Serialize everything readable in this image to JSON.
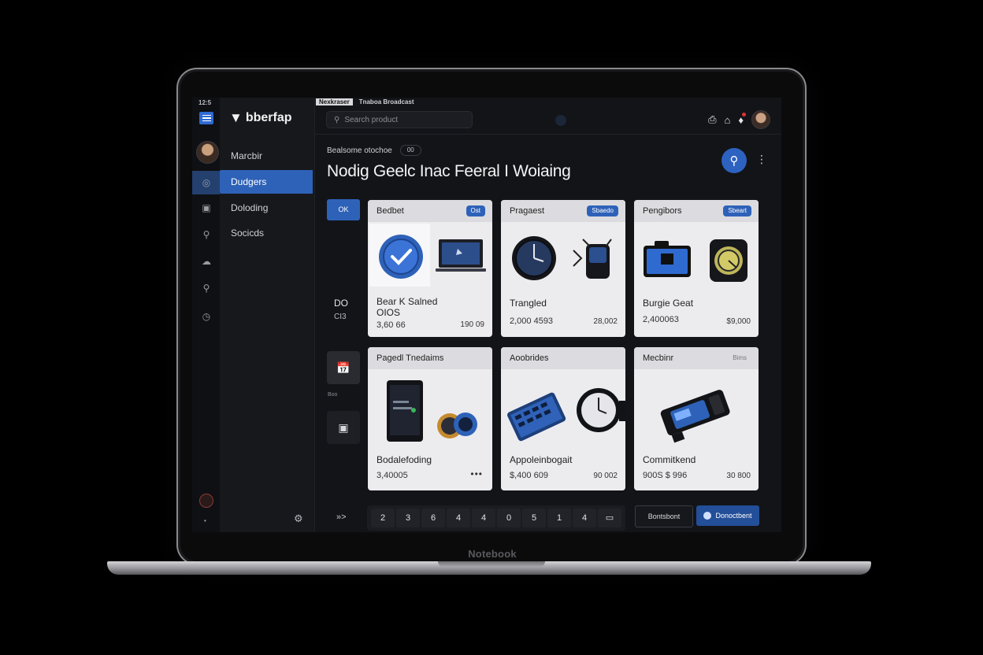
{
  "device": {
    "brand_label": "Notebook"
  },
  "rail": {
    "tiny_text": "12:5"
  },
  "app": {
    "logo_text": "bberfap"
  },
  "topbar": {
    "tabs": [
      "Nexkraser",
      "Tnaboa Broadcast"
    ],
    "search_placeholder": "Search product"
  },
  "nav": {
    "items": [
      {
        "label": "Marcbir"
      },
      {
        "label": "Dudgers"
      },
      {
        "label": "Doloding"
      },
      {
        "label": "Socicds"
      }
    ]
  },
  "header": {
    "breadcrumb": "Bealsome otochoe",
    "breadcrumb_pill": "00",
    "title": "Nodig Geelc Inac Feeral I Woiaing"
  },
  "left_column": {
    "ok_label": "OK",
    "stat_1": "DO",
    "stat_2": "CI3",
    "mini_label": "Boo"
  },
  "cards": [
    {
      "title": "Bedbet",
      "tag": "Ost",
      "name": "Bear K Salned\nOIOS",
      "value": "3,60 66",
      "price": "190 09"
    },
    {
      "title": "Pragaest",
      "tag": "Sbaedo",
      "name": "Trangled",
      "value": "2,000 4593",
      "price": "28,002"
    },
    {
      "title": "Pengibors",
      "tag": "Sbeart",
      "name": "Burgie Geat",
      "value": "2,400063",
      "price": "$9,000"
    },
    {
      "title": "Pagedl Tnedaims",
      "tag": "",
      "name": "Bodalefoding",
      "value": "3,40005",
      "price": ""
    },
    {
      "title": "Aoobrides",
      "tag": "",
      "name": "Appoleinbogait",
      "value": "$,400 609",
      "price": "90 002"
    },
    {
      "title": "Mecbinr",
      "tag": "Bims",
      "name": "Commitkend",
      "value": "900S $ 996",
      "price": "30 800"
    }
  ],
  "pager": {
    "prev_label": "»>",
    "pages": [
      "2",
      "3",
      "6",
      "4",
      "4",
      "0",
      "5",
      "1",
      "4",
      "▭"
    ]
  },
  "actions": {
    "secondary_label": "Bontsbont",
    "primary_label": "Donoctbent"
  },
  "colors": {
    "accent": "#2e62b8",
    "background": "#131418",
    "card": "#ececef"
  }
}
